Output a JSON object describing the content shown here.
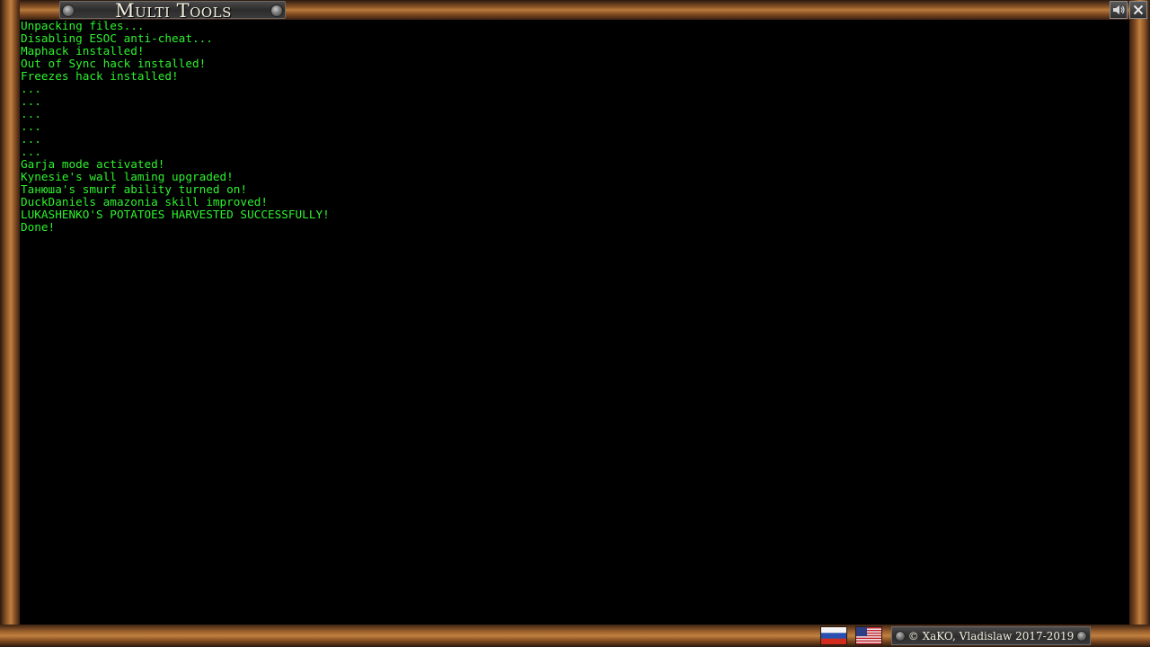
{
  "window": {
    "title": "Multi Tools",
    "sound_button_icon": "speaker-icon",
    "close_button_icon": "close-icon"
  },
  "console": {
    "text_color": "#2df22d",
    "background_color": "#000000",
    "lines": [
      "Unpacking files...",
      "Disabling ESOC anti-cheat...",
      "Maphack installed!",
      "Out of Sync hack installed!",
      "Freezes hack installed!",
      "...",
      "...",
      "...",
      "...",
      "...",
      "...",
      "Garja mode activated!",
      "Kynesie's wall laming upgraded!",
      "Танюша's smurf ability turned on!",
      "DuckDaniels amazonia skill improved!",
      "LUKASHENKO'S POTATOES HARVESTED SUCCESSFULLY!",
      "Done!"
    ]
  },
  "footer": {
    "language_flags": [
      "russia-flag-icon",
      "usa-flag-icon"
    ],
    "copyright": "© XaKO, Vladislaw 2017-2019"
  }
}
